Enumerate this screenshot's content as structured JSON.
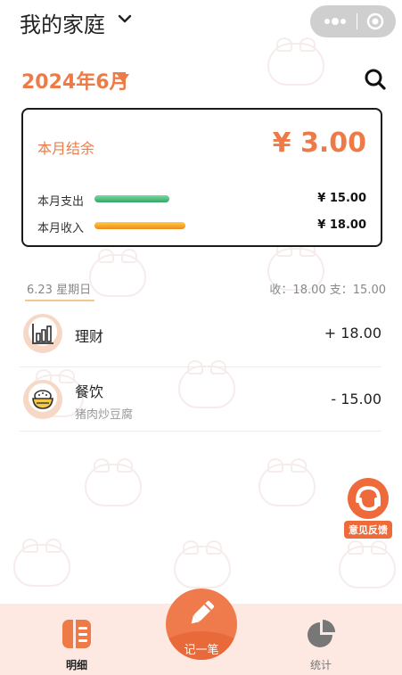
{
  "header": {
    "title": "我的家庭",
    "chevron_icon": "chevron-down-icon",
    "capsule_more_icon": "more-dots-icon",
    "capsule_close_icon": "target-close-icon"
  },
  "month_selector": {
    "label": "2024年6月",
    "arrow_icon": "triangle-down-icon",
    "search_icon": "search-icon"
  },
  "summary": {
    "balance_label": "本月结余",
    "balance_value": "¥ 3.00",
    "expense_label": "本月支出",
    "expense_value": "¥ 15.00",
    "income_label": "本月收入",
    "income_value": "¥ 18.00",
    "accent_color": "#ee7b47"
  },
  "day": {
    "date": "6.23 星期日",
    "totals": "收：18.00   支：15.00",
    "records": [
      {
        "icon": "chart-bars-icon",
        "name": "理财",
        "note": "",
        "amount": "+ 18.00"
      },
      {
        "icon": "rice-bowl-icon",
        "name": "餐饮",
        "note": "猪肉炒豆腐",
        "amount": "- 15.00"
      }
    ]
  },
  "feedback": {
    "icon": "feedback-headset-icon",
    "label": "意见反馈"
  },
  "tabbar": {
    "ledger_label": "明细",
    "add_label": "记一笔",
    "stats_label": "统计",
    "background": "#fde8e2"
  }
}
